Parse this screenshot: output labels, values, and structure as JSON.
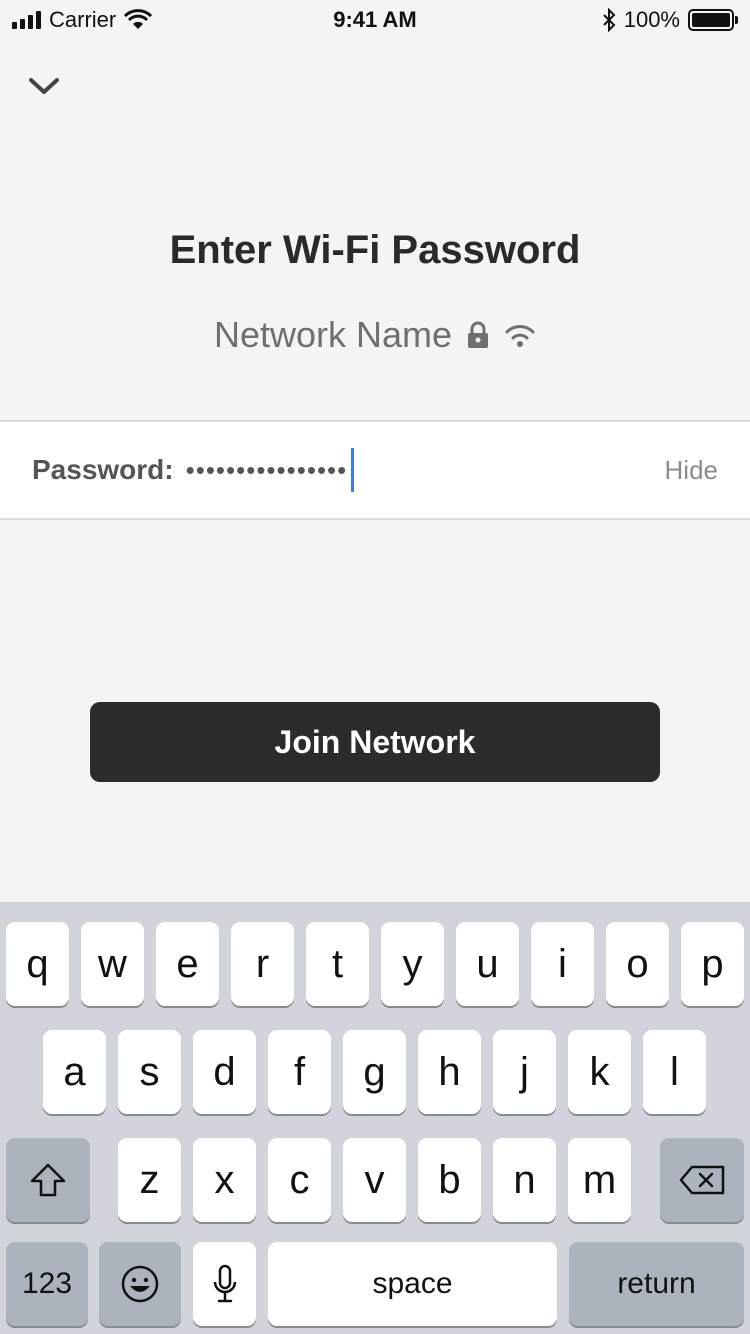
{
  "status_bar": {
    "carrier": "Carrier",
    "time": "9:41 AM",
    "battery_percent": "100%",
    "battery_level": 1.0
  },
  "header": {
    "collapse_icon": "chevron-down-icon",
    "title": "Enter Wi-Fi Password",
    "network_name": "Network Name",
    "lock_icon": "lock-icon",
    "wifi_icon": "wifi-icon"
  },
  "password": {
    "label": "Password:",
    "value": "••••••••••••••••",
    "toggle_label": "Hide"
  },
  "join_button": {
    "label": "Join Network"
  },
  "keyboard": {
    "row1": [
      "q",
      "w",
      "e",
      "r",
      "t",
      "y",
      "u",
      "i",
      "o",
      "p"
    ],
    "row2": [
      "a",
      "s",
      "d",
      "f",
      "g",
      "h",
      "j",
      "k",
      "l"
    ],
    "row3": [
      "z",
      "x",
      "c",
      "v",
      "b",
      "n",
      "m"
    ],
    "shift_icon": "shift-icon",
    "delete_icon": "backspace-icon",
    "numbers_label": "123",
    "emoji_icon": "emoji-icon",
    "mic_icon": "microphone-icon",
    "space_label": "space",
    "return_label": "return"
  },
  "colors": {
    "background": "#f4f4f4",
    "button": "#2b2b2b",
    "cursor": "#3d7ee0",
    "keyboard_bg": "#d1d4da",
    "function_key": "#acb3bd"
  }
}
